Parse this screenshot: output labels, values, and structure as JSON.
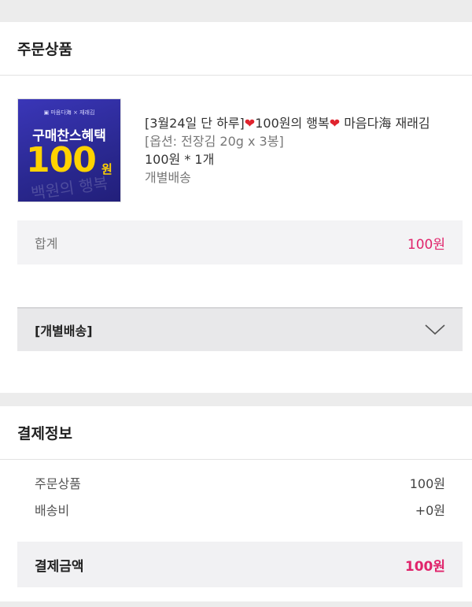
{
  "order": {
    "section_title": "주문상품",
    "product": {
      "thumb_top": "▣ 마음다海 × 재래김",
      "thumb_headline": "구매찬스혜택",
      "thumb_price": "100",
      "thumb_unit": "원",
      "thumb_script": "백원의 행복",
      "title_prefix": "[3월24일 단 하루]",
      "title_mid": "100원의 행복",
      "title_suffix": " 마음다海 재래김",
      "heart": "❤",
      "option": "[옵션: 전장김 20g x 3봉]",
      "price_qty": "100원 *  1개",
      "shipping_type": "개별배송"
    },
    "sum_label": "합계",
    "sum_value": "100원",
    "shipping_section_label": "[개별배송]"
  },
  "payment": {
    "section_title": "결제정보",
    "rows": [
      {
        "label": "주문상품",
        "value": "100원"
      },
      {
        "label": "배송비",
        "value": "+0원"
      }
    ],
    "total_label": "결제금액",
    "total_value": "100원"
  },
  "colors": {
    "accent": "#e0246b",
    "heart": "#e0242e"
  }
}
